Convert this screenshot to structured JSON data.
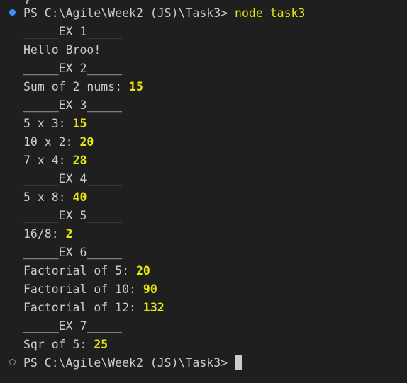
{
  "terminal": {
    "top_partial": "}",
    "prompt": "PS C:\\Agile\\Week2 (JS)\\Task3>",
    "command": "node task3",
    "lines": [
      {
        "label": "_____EX 1_____",
        "value": ""
      },
      {
        "label": "Hello Broo!",
        "value": ""
      },
      {
        "label": "_____EX 2_____",
        "value": ""
      },
      {
        "label": "Sum of 2 nums: ",
        "value": "15"
      },
      {
        "label": "_____EX 3_____",
        "value": ""
      },
      {
        "label": "5 x 3: ",
        "value": "15"
      },
      {
        "label": "10 x 2: ",
        "value": "20"
      },
      {
        "label": "7 x 4: ",
        "value": "28"
      },
      {
        "label": "_____EX 4_____",
        "value": ""
      },
      {
        "label": "5 x 8: ",
        "value": "40"
      },
      {
        "label": "_____EX 5_____",
        "value": ""
      },
      {
        "label": "16/8: ",
        "value": "2"
      },
      {
        "label": "_____EX 6_____",
        "value": ""
      },
      {
        "label": "Factorial of 5: ",
        "value": "20"
      },
      {
        "label": "Factorial of 10: ",
        "value": "90"
      },
      {
        "label": "Factorial of 12: ",
        "value": "132"
      },
      {
        "label": "_____EX 7_____",
        "value": ""
      },
      {
        "label": "Sqr of 5: ",
        "value": "25"
      }
    ],
    "final_prompt": "PS C:\\Agile\\Week2 (JS)\\Task3>"
  },
  "colors": {
    "background": "#1f1f1f",
    "text": "#cccccc",
    "highlight": "#e5e510",
    "status_dot_active": "#3794ff",
    "status_dot_idle": "#8a8a8a"
  }
}
